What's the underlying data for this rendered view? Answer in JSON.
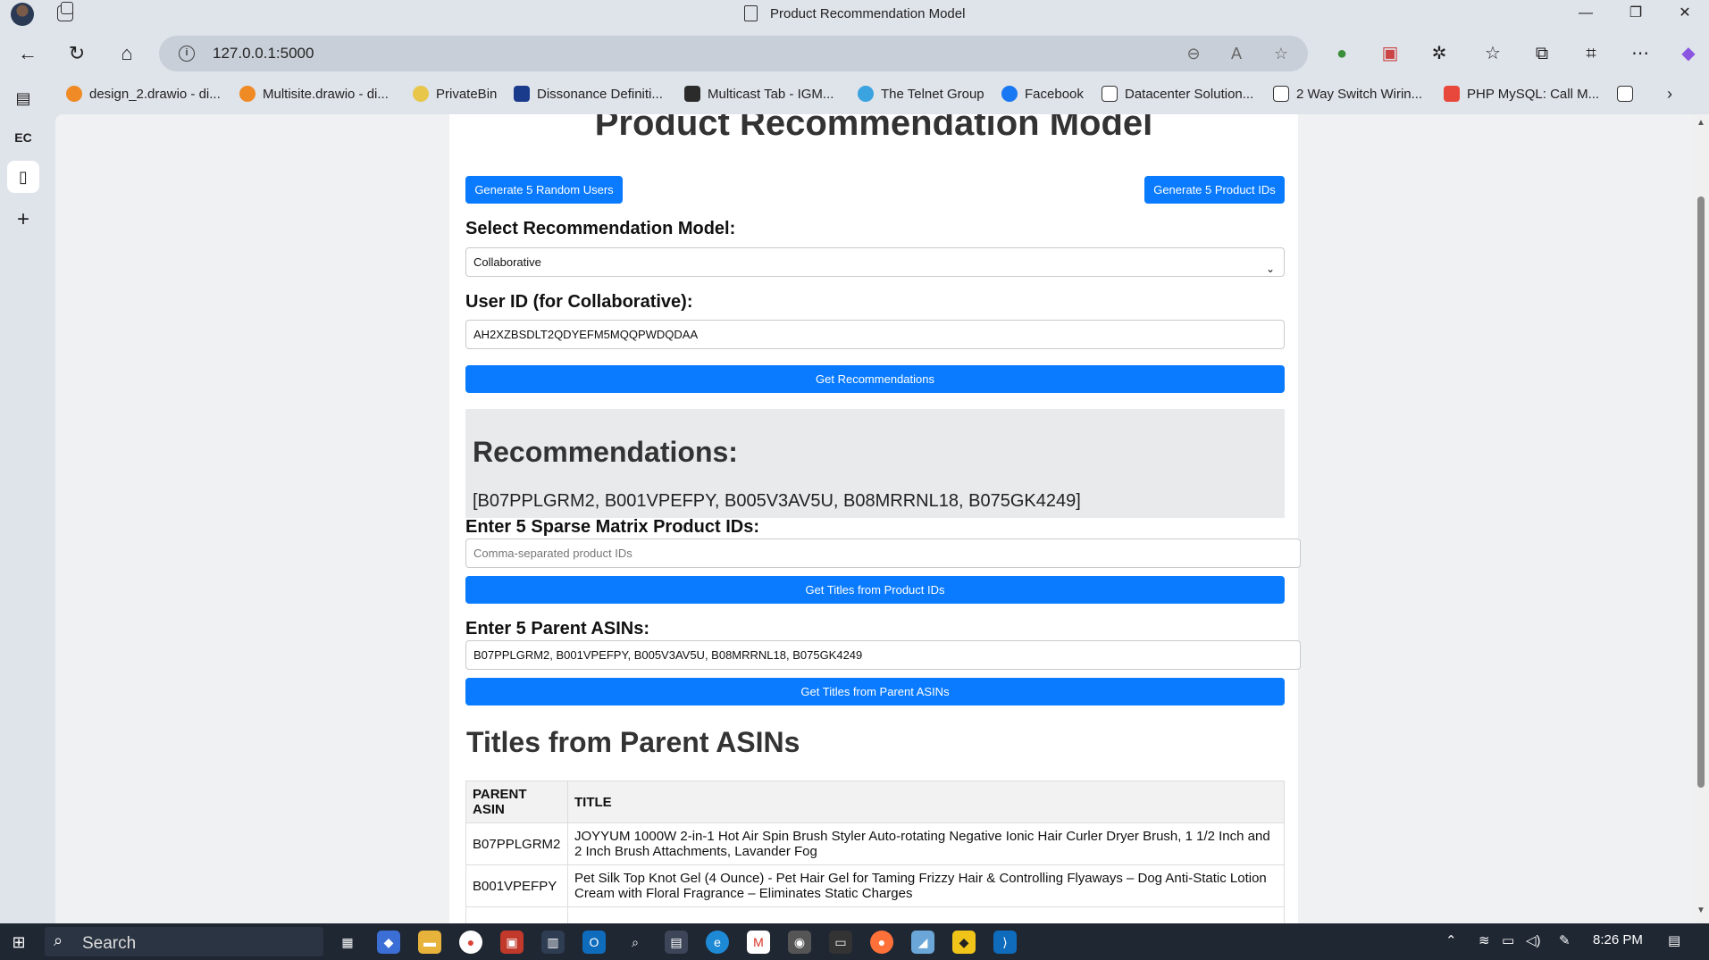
{
  "window": {
    "title": "Product Recommendation Model",
    "controls": [
      "—",
      "❐",
      "✕"
    ]
  },
  "toolbar": {
    "url": "127.0.0.1:5000"
  },
  "favorites": [
    {
      "label": "design_2.drawio - di...",
      "color": "#f08a24"
    },
    {
      "label": "Multisite.drawio - di...",
      "color": "#f08a24"
    },
    {
      "label": "PrivateBin",
      "color": "#e8c64a"
    },
    {
      "label": "Dissonance Definiti...",
      "color": "#1a3b8c"
    },
    {
      "label": "Multicast Tab - IGM...",
      "color": "#2b2b2b"
    },
    {
      "label": "The Telnet Group",
      "color": "#3aa3e0"
    },
    {
      "label": "Facebook",
      "color": "#1877f2"
    },
    {
      "label": "Datacenter Solution...",
      "color": "#ffffff"
    },
    {
      "label": "2 Way Switch Wirin...",
      "color": "#ffffff"
    },
    {
      "label": "PHP MySQL: Call M...",
      "color": "#e8483b"
    }
  ],
  "page": {
    "heading": "Product Recommendation Model",
    "btn_random_users": "Generate 5 Random Users",
    "btn_product_ids": "Generate 5 Product IDs",
    "model_label": "Select Recommendation Model:",
    "model_value": "Collaborative",
    "userid_label": "User ID (for Collaborative):",
    "userid_value": "AH2XZBSDLT2QDYEFM5MQQPWDQDAA",
    "btn_get_recs": "Get Recommendations",
    "recs_heading": "Recommendations:",
    "recs_ids": "[B07PPLGRM2, B001VPEFPY, B005V3AV5U, B08MRRNL18, B075GK4249]",
    "sparse_label": "Enter 5 Sparse Matrix Product IDs:",
    "sparse_placeholder": "Comma-separated product IDs",
    "btn_titles_product": "Get Titles from Product IDs",
    "asin_label": "Enter 5 Parent ASINs:",
    "asin_value": "B07PPLGRM2, B001VPEFPY, B005V3AV5U, B08MRRNL18, B075GK4249",
    "btn_titles_asin": "Get Titles from Parent ASINs",
    "titles_heading": "Titles from Parent ASINs",
    "table": {
      "headers": [
        "PARENT ASIN",
        "TITLE"
      ],
      "rows": [
        {
          "asin": "B07PPLGRM2",
          "title": "JOYYUM 1000W 2-in-1 Hot Air Spin Brush Styler Auto-rotating Negative Ionic Hair Curler Dryer Brush, 1 1/2 Inch and 2 Inch Brush Attachments, Lavander Fog"
        },
        {
          "asin": "B001VPEFPY",
          "title": "Pet Silk Top Knot Gel (4 Ounce) - Pet Hair Gel for Taming Frizzy Hair & Controlling Flyaways – Dog Anti-Static Lotion Cream with Floral Fragrance – Eliminates Static Charges"
        }
      ]
    }
  },
  "taskbar": {
    "search": "Search",
    "time": "8:26 PM"
  }
}
